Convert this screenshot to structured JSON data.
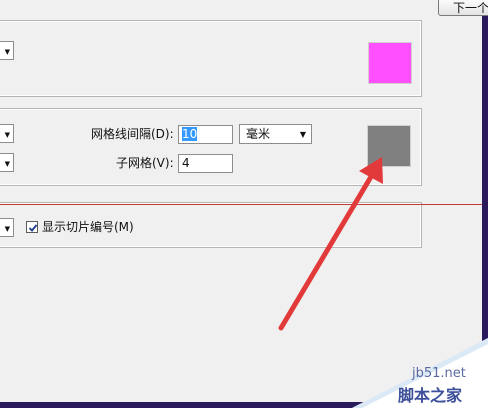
{
  "header": {
    "next_label": "下一个"
  },
  "guides": {
    "color_hex": "#ff4fff"
  },
  "grid": {
    "spacing_label": "网格线间隔(D):",
    "spacing_value": "10",
    "unit_value": "毫米",
    "subdivisions_label": "子网格(V):",
    "subdivisions_value": "4",
    "color_hex": "#808080"
  },
  "slices": {
    "show_numbers_label": "显示切片编号(M)",
    "show_numbers_checked": true
  },
  "watermark": {
    "site": "jb51.net",
    "name": "脚本之家"
  }
}
